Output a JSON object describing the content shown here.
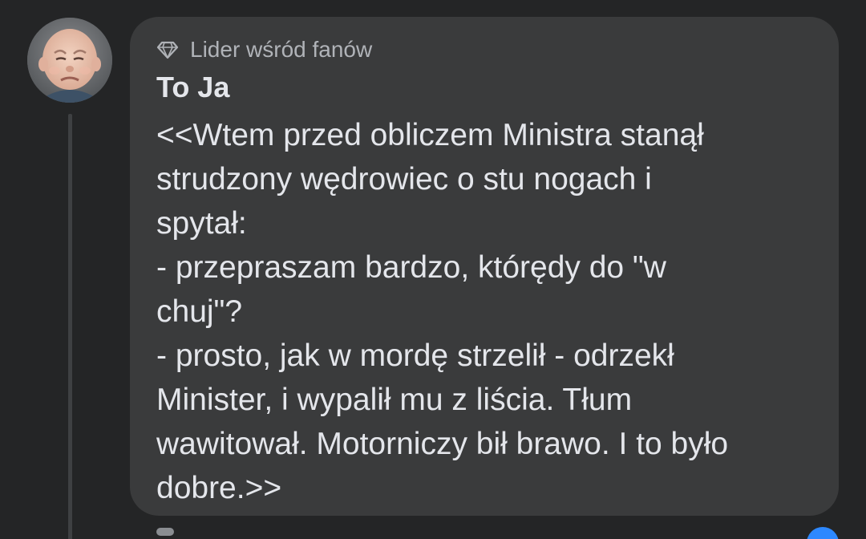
{
  "comment": {
    "badge": {
      "icon": "diamond-icon",
      "label": "Lider wśród fanów"
    },
    "author": "To Ja",
    "body_lines": [
      "<<Wtem przed obliczem Ministra stanął",
      "strudzony wędrowiec o stu nogach i",
      "spytał:",
      "- przepraszam bardzo, którędy do \"w",
      "chuj\"?",
      "- prosto, jak w mordę strzelił - odrzekł",
      "Minister, i wypalił mu z liścia. Tłum",
      "wawitował. Motorniczy bił brawo. I to było",
      "dobre.>>"
    ]
  },
  "colors": {
    "background": "#242526",
    "bubble": "#3a3b3c",
    "text_primary": "#e4e6eb",
    "text_secondary": "#b0b3b8",
    "reaction": "#2d88ff"
  }
}
